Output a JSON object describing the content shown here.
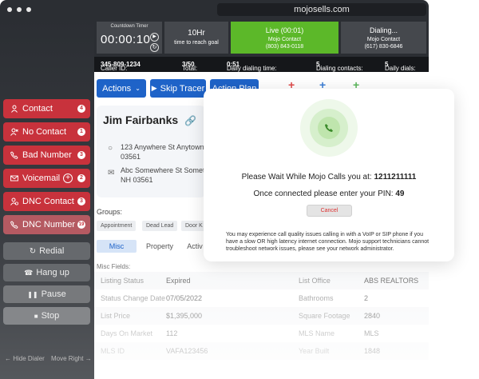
{
  "browser": {
    "url": "mojosells.com"
  },
  "sidebar": {
    "dispositions": [
      {
        "label": "Contact",
        "badge": "4",
        "icon": "person-icon"
      },
      {
        "label": "No Contact",
        "badge": "1",
        "icon": "person-x-icon"
      },
      {
        "label": "Bad Number",
        "badge": "3",
        "icon": "phone-x-icon"
      },
      {
        "label": "Voicemail",
        "badge": "2",
        "icon": "voicemail-icon",
        "extra": "+"
      },
      {
        "label": "DNC Contact",
        "badge": "3",
        "icon": "person-block-icon"
      },
      {
        "label": "DNC Number",
        "badge": "19",
        "icon": "phone-block-icon"
      }
    ],
    "controls": [
      {
        "label": "Redial",
        "icon": "redial-icon"
      },
      {
        "label": "Hang up",
        "icon": "hangup-icon"
      },
      {
        "label": "Pause",
        "icon": "pause-icon"
      },
      {
        "label": "Stop",
        "icon": "stop-icon"
      }
    ],
    "hide_dialer": "Hide Dialer",
    "move_right": "Move Right"
  },
  "topbar": {
    "countdown": {
      "label": "Countdown Timer",
      "hh": "00",
      "mm": "00",
      "ss": "10"
    },
    "goal": {
      "value": "10Hr",
      "label": "time to reach goal"
    },
    "live": {
      "title": "Live (00:01)",
      "name": "Mojo Contact",
      "phone": "(803) 843-0118"
    },
    "dialing": {
      "title": "Dialing...",
      "name": "Mojo Contact",
      "phone": "(617) 830-6846"
    }
  },
  "status": {
    "caller_id_label": "Caller ID:",
    "caller_id": "345-809-1234",
    "total_label": "Total:",
    "total": "3/50",
    "daily_time_label": "Daily dialing time:",
    "daily_time": "0:51",
    "dialing_contacts_label": "Dialing contacts:",
    "dialing_contacts": "5",
    "daily_dials_label": "Daily dials:",
    "daily_dials": "5"
  },
  "actions": {
    "actions_label": "Actions",
    "skip_tracer_label": "Skip Tracer",
    "action_plan_label": "Action Plan",
    "plus_colors": [
      "#e04b4b",
      "#3d7fd6",
      "#5cb85c"
    ]
  },
  "contact": {
    "name": "Jim Fairbanks",
    "address1_line1": "123 Anywhere St Anytown",
    "address1_line2": "03561",
    "address2_line1": "Abc Somewhere St Someto",
    "address2_line2": "NH 03561"
  },
  "groups": {
    "label": "Groups:",
    "chips": [
      "Appointment",
      "Dead Lead",
      "Door K"
    ]
  },
  "subtabs": [
    "Misc",
    "Property",
    "Activ"
  ],
  "misc": {
    "label": "Misc Fields:",
    "rows": [
      {
        "k1": "Listing Status",
        "v1": "Expired",
        "k2": "List Office",
        "v2": "ABS REALTORS"
      },
      {
        "k1": "Status Change Date",
        "v1": "07/05/2022",
        "k2": "Bathrooms",
        "v2": "2"
      },
      {
        "k1": "List Price",
        "v1": "$1,395,000",
        "k2": "Square Footage",
        "v2": "2840"
      },
      {
        "k1": "Days On Market",
        "v1": "112",
        "k2": "MLS Name",
        "v2": "MLS"
      },
      {
        "k1": "MLS ID",
        "v1": "VAFA123456",
        "k2": "Year Built",
        "v2": "1848"
      }
    ]
  },
  "modal": {
    "wait_text": "Please Wait While Mojo Calls you at:",
    "wait_number": "1211211111",
    "pin_text": "Once connected please enter your PIN:",
    "pin": "49",
    "cancel_label": "Cancel",
    "note": "You may experience call quality issues calling in with a VoIP or SIP phone if you have a slow OR high latency internet connection. Mojo support technicians cannot troubleshoot network issues, please see your network administrator."
  }
}
